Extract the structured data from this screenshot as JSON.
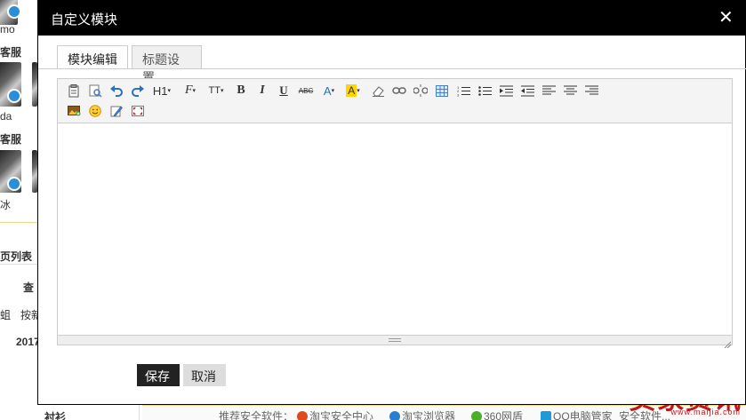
{
  "background": {
    "texts": [
      "mo",
      "客服",
      "da",
      "客服",
      "冰",
      "页列表",
      "查",
      "蛆",
      "按新",
      "2017",
      "衬衫"
    ],
    "footer": {
      "label": "推荐安全软件：",
      "items": [
        "淘宝安全中心",
        "淘宝浏览器",
        "360网盾",
        "QQ电脑管家",
        "安全软件..."
      ]
    },
    "watermark": "卖家资讯",
    "watermark_sub": "www.maijia.com"
  },
  "dialog": {
    "title": "自定义模块",
    "close_label": "✕",
    "tabs": [
      {
        "label": "模块编辑",
        "active": true
      },
      {
        "label": "标题设置",
        "active": false
      }
    ],
    "toolbar": {
      "row1": [
        "paste-icon",
        "preview-icon",
        "undo-icon",
        "redo-icon",
        "heading-dropdown",
        "font-family-dropdown",
        "font-size-dropdown",
        "bold-icon",
        "italic-icon",
        "underline-icon",
        "strikethrough-icon",
        "font-color-dropdown",
        "highlight-color-dropdown",
        "eraser-icon",
        "link-icon",
        "unlink-icon",
        "table-icon",
        "ordered-list-icon",
        "unordered-list-icon",
        "indent-icon",
        "outdent-icon",
        "align-left-icon",
        "align-center-icon",
        "align-right-icon"
      ],
      "row2": [
        "insert-image-icon",
        "emoticon-icon",
        "source-code-icon",
        "fullscreen-icon"
      ],
      "heading_label": "H1",
      "font_family_label": "F",
      "font_size_label": "TT",
      "bold_label": "B",
      "italic_label": "I",
      "underline_label": "U",
      "strike_label": "ABC",
      "font_color_label": "A",
      "highlight_label": "A"
    },
    "buttons": {
      "save": "保存",
      "cancel": "取消"
    }
  }
}
